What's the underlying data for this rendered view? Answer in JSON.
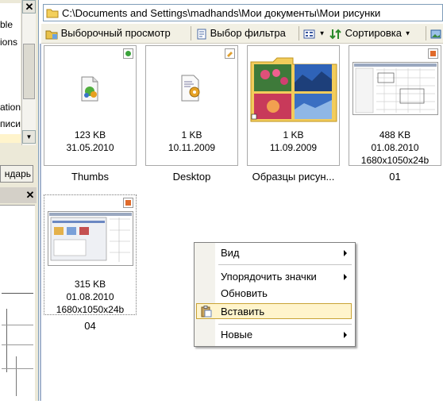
{
  "left_pane": {
    "list_items": [
      "ble",
      "ions",
      "",
      "",
      "ation",
      "писи"
    ],
    "tab_label": "ндарь"
  },
  "address_bar": {
    "path": "C:\\Documents and Settings\\madhands\\Мои документы\\Мои рисунки"
  },
  "toolbar": {
    "preview_label": "Выборочный просмотр",
    "filter_label": "Выбор фильтра",
    "sort_label": "Сортировка"
  },
  "files": [
    {
      "name": "Thumbs",
      "size": "123 KB",
      "date": "31.05.2010",
      "dims": "",
      "icon": "db-file-icon"
    },
    {
      "name": "Desktop",
      "size": "1 KB",
      "date": "10.11.2009",
      "dims": "",
      "icon": "ini-file-icon"
    },
    {
      "name": "Образцы рисун...",
      "size": "1 KB",
      "date": "11.09.2009",
      "dims": "",
      "icon": "folder-icon"
    },
    {
      "name": "01",
      "size": "488 KB",
      "date": "01.08.2010",
      "dims": "1680x1050x24b",
      "icon": "image-thumbnail"
    },
    {
      "name": "04",
      "size": "315 KB",
      "date": "01.08.2010",
      "dims": "1680x1050x24b",
      "icon": "image-thumbnail"
    }
  ],
  "context_menu": {
    "items": [
      {
        "label": "Вид",
        "submenu": true
      },
      {
        "label": "Упорядочить значки",
        "submenu": true
      },
      {
        "label": "Обновить",
        "submenu": false
      },
      {
        "label": "Вставить",
        "submenu": false,
        "highlighted": true
      },
      {
        "label": "Новые",
        "submenu": true
      }
    ]
  },
  "colors": {
    "highlight_bg": "#fff4cc",
    "highlight_border": "#c9a336",
    "accent_border": "#7f9db9"
  }
}
